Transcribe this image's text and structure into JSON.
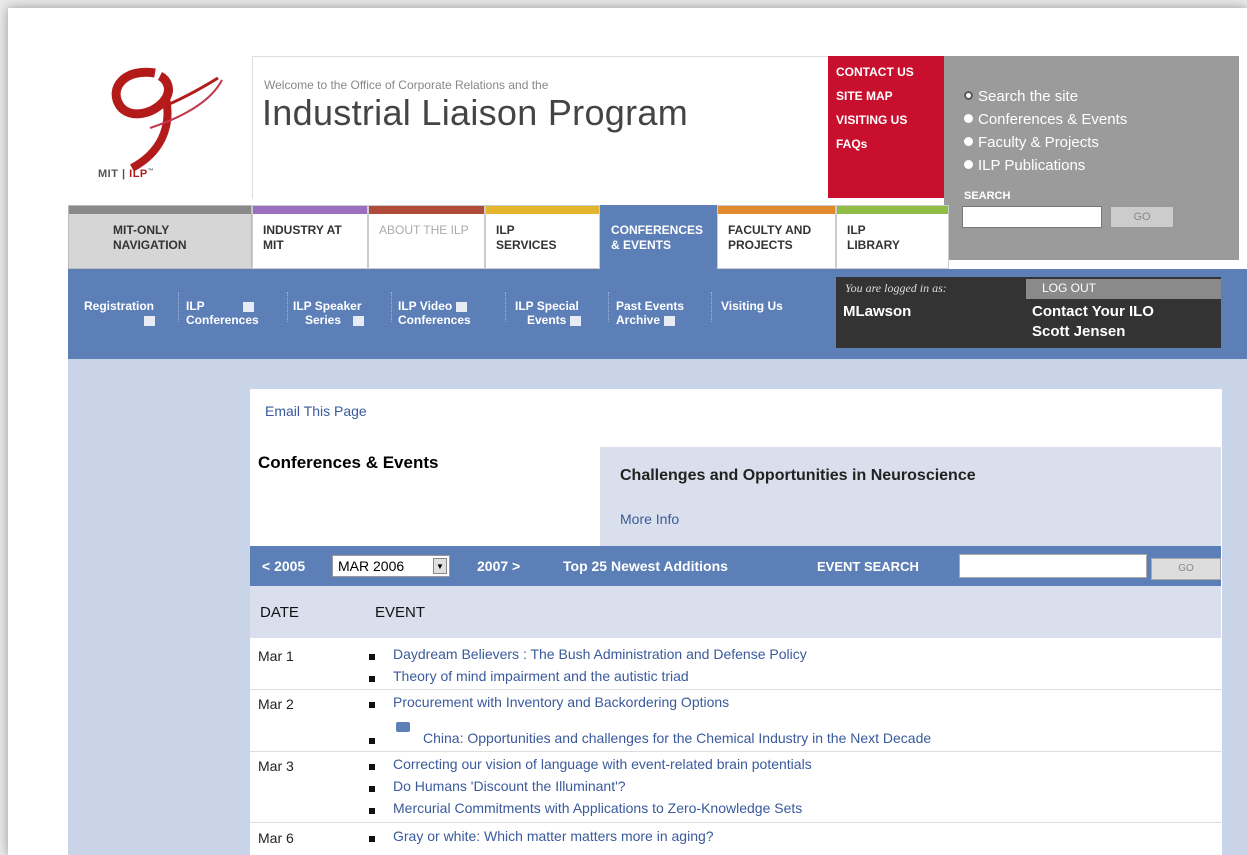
{
  "header": {
    "logo": {
      "mit": "MIT",
      "ilp": "ILP"
    },
    "welcome_small": "Welcome to the Office of Corporate Relations and the",
    "welcome_big": "Industrial Liaison Program"
  },
  "quick_links": [
    "CONTACT US",
    "SITE MAP",
    "VISITING US",
    "FAQs"
  ],
  "search": {
    "options": [
      "Search the site",
      "Conferences & Events",
      "Faculty & Projects",
      "ILP Publications"
    ],
    "selected": "Search the site",
    "label": "SEARCH",
    "go_label": "GO"
  },
  "main_nav": [
    {
      "label": "MIT-ONLY NAVIGATION",
      "color": "#8a8a8a"
    },
    {
      "label": "INDUSTRY AT MIT",
      "color": "#9b6fc0"
    },
    {
      "label": "ABOUT THE ILP",
      "color": "#b04a3a"
    },
    {
      "label": "ILP SERVICES",
      "color": "#e3b52e"
    },
    {
      "label": "CONFERENCES & EVENTS",
      "color": "#5d7fb7"
    },
    {
      "label": "FACULTY AND PROJECTS",
      "color": "#e0892e"
    },
    {
      "label": "ILP LIBRARY",
      "color": "#8fbc45"
    }
  ],
  "sub_nav": [
    {
      "line1": "Registration",
      "line2": ""
    },
    {
      "line1": "ILP",
      "line2": "Conferences"
    },
    {
      "line1": "ILP Speaker",
      "line2": "Series"
    },
    {
      "line1": "ILP Video",
      "line2": "Conferences"
    },
    {
      "line1": "ILP Special",
      "line2": "Events"
    },
    {
      "line1": "Past Events",
      "line2": "Archive"
    },
    {
      "line1": "Visiting Us",
      "line2": ""
    }
  ],
  "user": {
    "logged_label": "You are logged in as:",
    "name": "MLawson",
    "logout_label": "LOG OUT",
    "contact_label": "Contact Your ILO",
    "ilo_name": "Scott Jensen"
  },
  "content": {
    "email_link": "Email This Page",
    "title": "Conferences & Events",
    "promo_title": "Challenges and Opportunities in Neuroscience",
    "promo_more": "More Info"
  },
  "filter": {
    "prev": "< 2005",
    "selected_month": "MAR 2006",
    "next": "2007 >",
    "newest": "Top 25 Newest Additions",
    "search_label": "EVENT SEARCH",
    "go_label": "GO"
  },
  "table": {
    "headers": [
      "DATE",
      "EVENT"
    ],
    "rows": [
      {
        "date": "Mar 1",
        "events": [
          "Daydream Believers : The Bush Administration and Defense Policy",
          "Theory of mind impairment and the autistic triad"
        ]
      },
      {
        "date": "Mar 2",
        "events": [
          "Procurement with Inventory and Backordering Options",
          "China: Opportunities and challenges for the Chemical Industry in the Next Decade"
        ]
      },
      {
        "date": "Mar 3",
        "events": [
          "Correcting our vision of language with event-related brain potentials",
          "Do Humans 'Discount the Illuminant'?",
          "Mercurial Commitments with Applications to Zero-Knowledge Sets"
        ]
      },
      {
        "date": "Mar 6",
        "events": [
          "Gray or white: Which matter matters more in aging?"
        ]
      }
    ]
  }
}
